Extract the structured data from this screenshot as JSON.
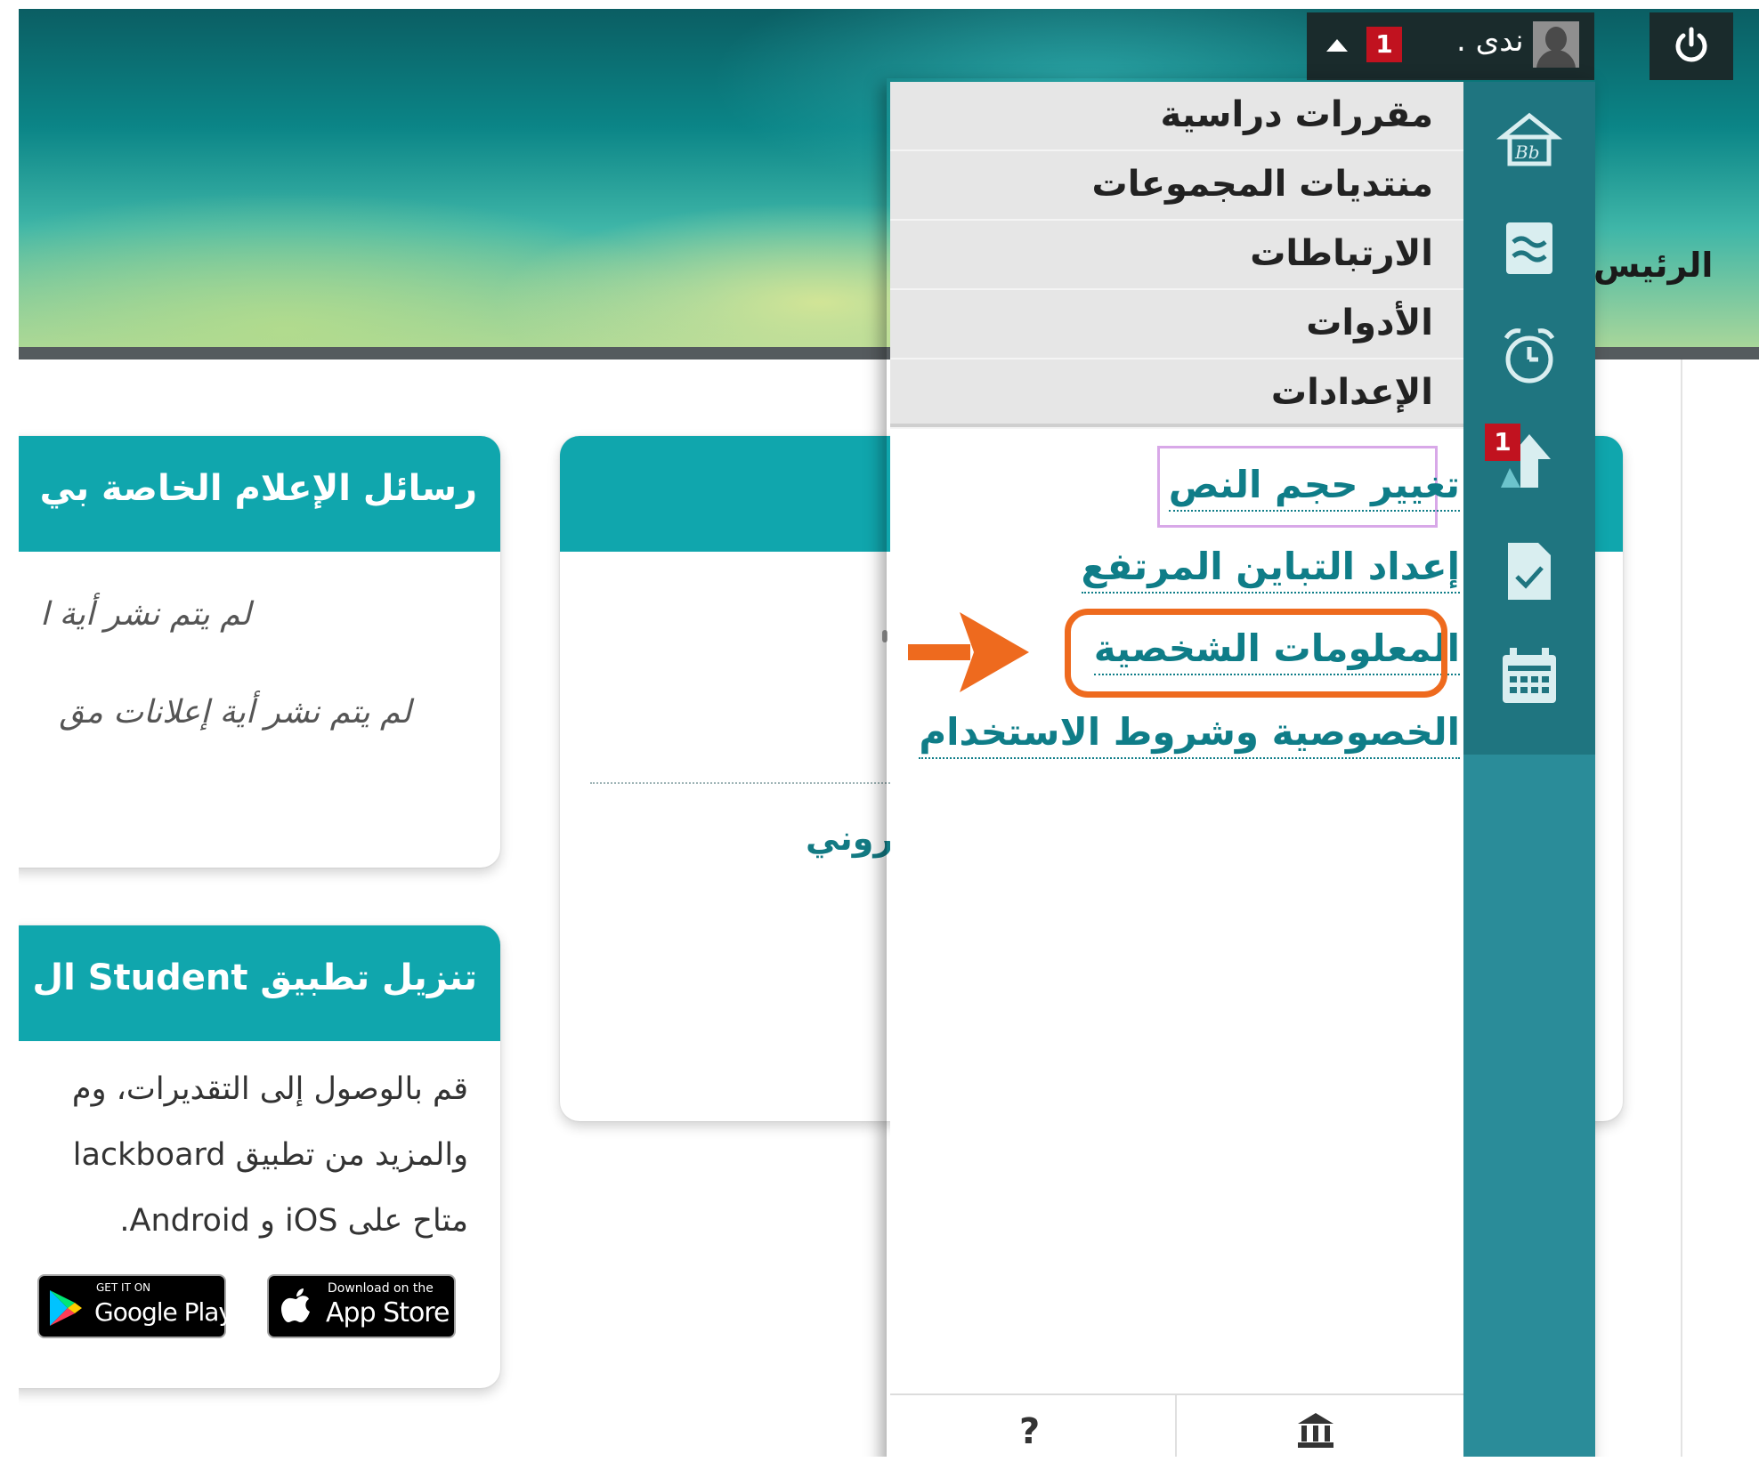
{
  "header": {
    "user_name": "ندى .",
    "notification_count": "1",
    "home_tab_label": "الرئيس"
  },
  "dropdown": {
    "menu_items": [
      {
        "label": "مقررات دراسية"
      },
      {
        "label": "منتديات المجموعات"
      },
      {
        "label": "الارتباطات"
      },
      {
        "label": "الأدوات"
      },
      {
        "label": "الإعدادات"
      }
    ],
    "links": [
      {
        "label": "تغيير حجم النص"
      },
      {
        "label": "إعداد التباين المرتفع"
      },
      {
        "label": "المعلومات الشخصية"
      },
      {
        "label": "الخصوصية وشروط الاستخدام"
      }
    ],
    "sidebar_badge": "1",
    "help_label": "?",
    "sidebar_icons": [
      "blackboard-home-icon",
      "activity-stream-icon",
      "due-dates-alarm-icon",
      "updates-icon",
      "grades-icon",
      "calendar-icon"
    ]
  },
  "cards": {
    "messages": {
      "title": "رسائل الإعلام الخاصة بي",
      "line1": "لم يتم نشر أية ا",
      "line2": "لم يتم نشر أية إعلانات مق"
    },
    "app": {
      "title": "تنزيل تطبيق Student ال",
      "line1": "قم بالوصول إلى التقديرات، وم",
      "line2": "والمزيد من تطبيق lackboard",
      "line3": "متاح على iOS و Android.",
      "google_small": "GET IT ON",
      "google_big": "Google Play",
      "apple_small": "Download on the",
      "apple_big": "App Store"
    },
    "middle": {
      "text": "روني"
    }
  },
  "colors": {
    "accent_teal": "#10a6ad",
    "link_teal": "#0f7d88",
    "highlight_orange": "#ee6a1e",
    "badge_red": "#c1121f"
  }
}
